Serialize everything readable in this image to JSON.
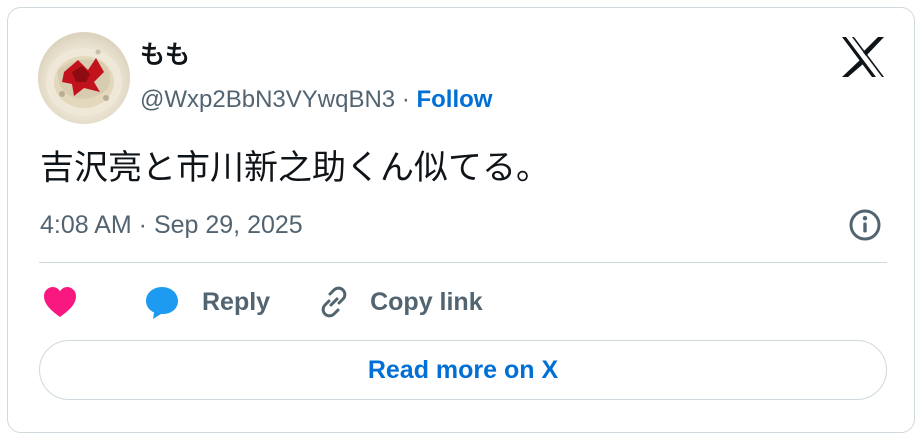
{
  "user": {
    "display_name": "もも",
    "handle": "@Wxp2BbN3VYwqBN3",
    "separator": "·",
    "follow_label": "Follow"
  },
  "tweet": {
    "text": "吉沢亮と市川新之助くん似てる。",
    "timestamp": "4:08 AM · Sep 29, 2025"
  },
  "actions": {
    "reply_label": "Reply",
    "copy_link_label": "Copy link"
  },
  "read_more_label": "Read more on X",
  "colors": {
    "accent": "#006fd6",
    "secondary_text": "#536471",
    "heart": "#f91880",
    "reply_icon": "#1d9bf0",
    "border": "#cfd9de"
  },
  "icons": {
    "brand": "x-logo-icon",
    "like": "heart-icon",
    "reply": "speech-bubble-icon",
    "copy": "link-icon",
    "info": "info-icon"
  }
}
